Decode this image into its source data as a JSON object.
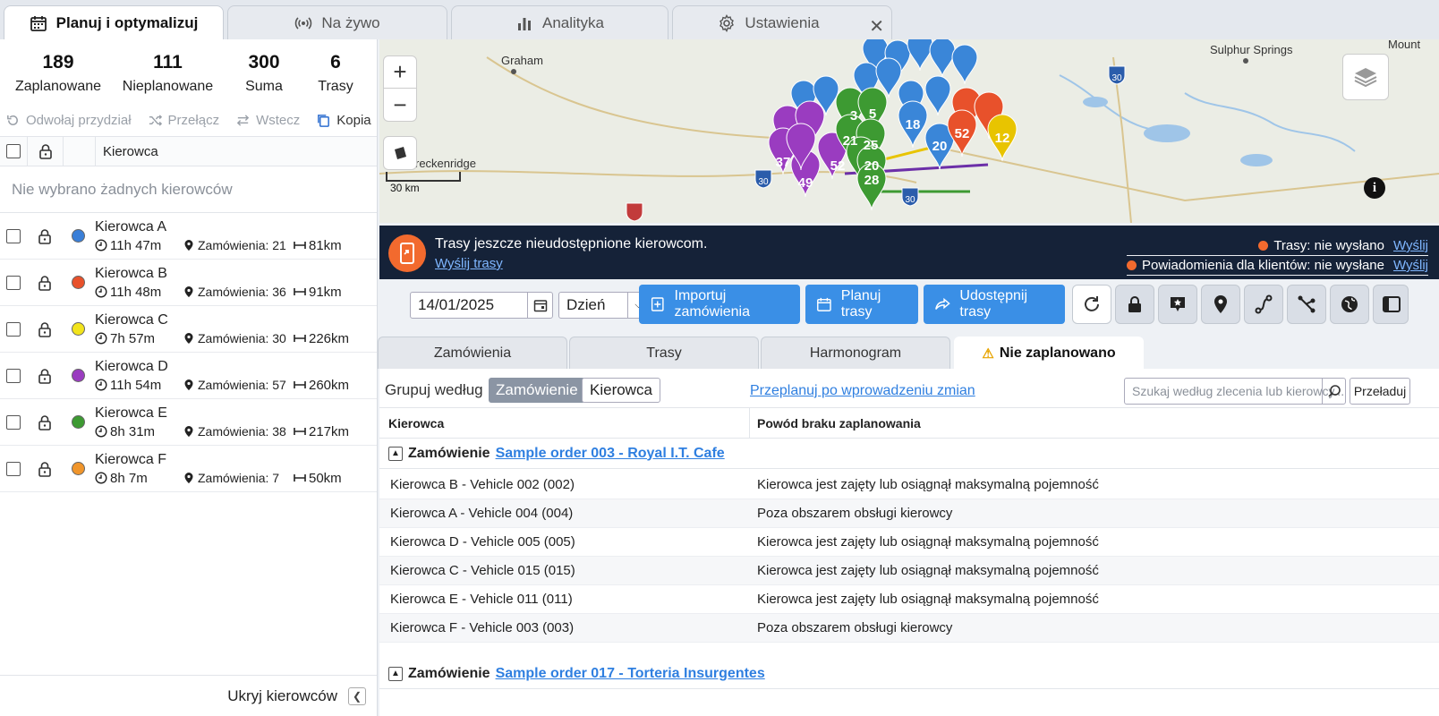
{
  "top_tabs": [
    {
      "label": "Planuj i optymalizuj",
      "icon": "calendar-icon"
    },
    {
      "label": "Na żywo",
      "icon": "broadcast-icon"
    },
    {
      "label": "Analityka",
      "icon": "bar-chart-icon"
    },
    {
      "label": "Ustawienia",
      "icon": "gear-icon"
    }
  ],
  "close_symbol": "✕",
  "stats": [
    {
      "value": "189",
      "label": "Zaplanowane"
    },
    {
      "value": "111",
      "label": "Nieplanowane"
    },
    {
      "value": "300",
      "label": "Suma"
    },
    {
      "value": "6",
      "label": "Trasy"
    }
  ],
  "actions": {
    "unassign": "Odwołaj przydział",
    "switch": "Przełącz",
    "back": "Wstecz",
    "copy": "Kopia"
  },
  "driver_table": {
    "header": "Kierowca",
    "empty": "Nie wybrano żadnych kierowców"
  },
  "drivers": [
    {
      "name": "Kierowca A",
      "time": "11h 47m",
      "orders": "Zamówienia: 21",
      "distance": "81km",
      "color": "#3a7fd8"
    },
    {
      "name": "Kierowca B",
      "time": "11h 48m",
      "orders": "Zamówienia: 36",
      "distance": "91km",
      "color": "#e8512b"
    },
    {
      "name": "Kierowca C",
      "time": "7h 57m",
      "orders": "Zamówienia: 30",
      "distance": "226km",
      "color": "#f2e41c"
    },
    {
      "name": "Kierowca D",
      "time": "11h 54m",
      "orders": "Zamówienia: 57",
      "distance": "260km",
      "color": "#9a3cc0"
    },
    {
      "name": "Kierowca E",
      "time": "8h 31m",
      "orders": "Zamówienia: 38",
      "distance": "217km",
      "color": "#3d9a32"
    },
    {
      "name": "Kierowca F",
      "time": "8h 7m",
      "orders": "Zamówienia: 7",
      "distance": "50km",
      "color": "#f0952b"
    }
  ],
  "hide_drivers": "Ukryj kierowców",
  "map": {
    "labels": {
      "graham": "Graham",
      "sulphur": "Sulphur Springs",
      "mount": "Mount",
      "breckenridge": "reckenridge"
    },
    "scale": "30 km",
    "pins": {
      "p1": "18",
      "p2": "20",
      "p3": "52",
      "p4": "12",
      "p5": "37",
      "p6": "49",
      "p7": "52",
      "p8": "21",
      "p9": "25",
      "p10": "20",
      "p11": "28",
      "p12": "3",
      "p13": "5"
    },
    "shields": {
      "s1": "30",
      "s2": "30",
      "s3": "30"
    }
  },
  "banner": {
    "message": "Trasy jeszcze nieudostępnione kierowcom.",
    "link": "Wyślij trasy",
    "routes_status": "Trasy: nie wysłano",
    "routes_link": "Wyślij",
    "notif_status": "Powiadomienia dla klientów: nie wysłane",
    "notif_link": "Wyślij"
  },
  "toolbar": {
    "date": "14/01/2025",
    "period": "Dzień",
    "import": "Importuj zamówienia",
    "plan": "Planuj trasy",
    "share": "Udostępnij trasy"
  },
  "sub_tabs": [
    "Zamówienia",
    "Trasy",
    "Harmonogram",
    "Nie zaplanowano"
  ],
  "group": {
    "label": "Grupuj według",
    "opt_order": "Zamówienie",
    "opt_driver": "Kierowca",
    "replan": "Przeplanuj po wprowadzeniu zmian",
    "search_placeholder": "Szukaj według zlecenia lub kierowcy...",
    "reload": "Przeładuj"
  },
  "table": {
    "col_driver": "Kierowca",
    "col_reason": "Powód braku zaplanowania"
  },
  "groups": [
    {
      "prefix": "Zamówienie",
      "order": "Sample order 003 - Royal I.T. Cafe",
      "rows": [
        {
          "driver": "Kierowca B - Vehicle 002 (002)",
          "reason": "Kierowca jest zajęty lub osiągnął maksymalną pojemność"
        },
        {
          "driver": "Kierowca A - Vehicle 004 (004)",
          "reason": "Poza obszarem obsługi kierowcy"
        },
        {
          "driver": "Kierowca D - Vehicle 005 (005)",
          "reason": "Kierowca jest zajęty lub osiągnął maksymalną pojemność"
        },
        {
          "driver": "Kierowca C - Vehicle 015 (015)",
          "reason": "Kierowca jest zajęty lub osiągnął maksymalną pojemność"
        },
        {
          "driver": "Kierowca E - Vehicle 011 (011)",
          "reason": "Kierowca jest zajęty lub osiągnął maksymalną pojemność"
        },
        {
          "driver": "Kierowca F - Vehicle 003 (003)",
          "reason": "Poza obszarem obsługi kierowcy"
        }
      ]
    },
    {
      "prefix": "Zamówienie",
      "order": "Sample order 017 - Torteria Insurgentes",
      "rows": []
    }
  ]
}
